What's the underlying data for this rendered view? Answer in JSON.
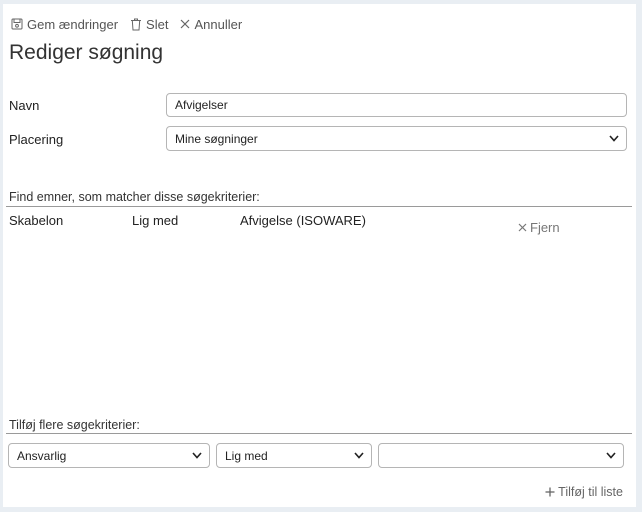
{
  "toolbar": {
    "save_label": "Gem ændringer",
    "delete_label": "Slet",
    "cancel_label": "Annuller"
  },
  "page": {
    "title": "Rediger søgning"
  },
  "form": {
    "name_label": "Navn",
    "name_value": "Afvigelser",
    "location_label": "Placering",
    "location_value": "Mine søgninger"
  },
  "criteria": {
    "section_title": "Find emner, som matcher disse søgekriterier:",
    "rows": [
      {
        "field": "Skabelon",
        "operator": "Lig med",
        "value": "Afvigelse (ISOWARE)",
        "remove_label": "Fjern"
      }
    ]
  },
  "add_criteria": {
    "section_title": "Tilføj flere søgekriterier:",
    "field_value": "Ansvarlig",
    "operator_value": "Lig med",
    "value_value": "",
    "add_label": "Tilføj til liste"
  },
  "colors": {
    "background": "#e9eef3",
    "panel": "#ffffff",
    "border": "#b5b5b5"
  }
}
